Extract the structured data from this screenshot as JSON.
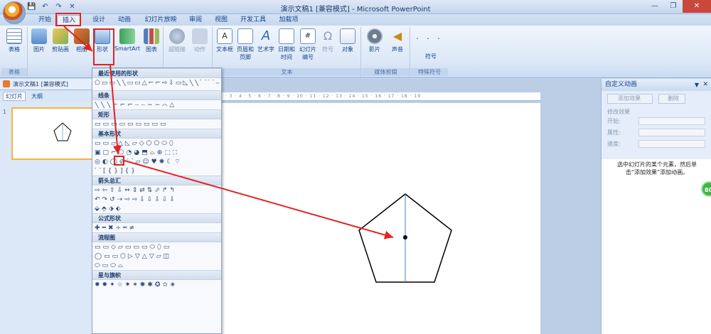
{
  "window": {
    "title": "演示文稿1 [兼容模式] - Microsoft PowerPoint",
    "qat_save": "💾",
    "qat_undo": "↶",
    "qat_redo": "↷",
    "qat_close": "✕",
    "minimize": "—",
    "restore": "❐",
    "close": "✕"
  },
  "ribbon_tabs": [
    "开始",
    "插入",
    "设计",
    "动画",
    "幻灯片放映",
    "审阅",
    "视图",
    "开发工具",
    "加载项"
  ],
  "ribbon": {
    "groups": [
      "表格",
      "插图",
      "链接",
      "文本",
      "媒体剪辑",
      "特殊符号"
    ],
    "buttons": {
      "table": "表格",
      "picture": "图片",
      "clipart": "剪贴画",
      "album": "相册",
      "shapes": "形状",
      "smartart": "SmartArt",
      "chart": "图表",
      "hyperlink": "超链接",
      "action": "动作",
      "textbox": "文本框",
      "header_footer": "页眉和页脚",
      "wordart": "艺术字",
      "datetime": "日期和时间",
      "slide_number": "幻灯片编号",
      "symbol": "符号",
      "object": "对象",
      "movie": "影片",
      "sound": "声音",
      "special_symbol": "符号"
    }
  },
  "left_pane": {
    "doc_tab": "演示文稿1 [兼容模式]",
    "tab_slides": "幻灯片",
    "tab_outline": "大纲",
    "slide_index": "1"
  },
  "ruler_text": "9 · 8 · 7 · 6 · 5 · 4 · 3 · 2 · 1 · 0 · 1 · 2 · 3 · 4 · 5 · 6 · 7 · 8 · 9 · 10 · 11 · 12 · 13 · 14 · 15 · 16 · 17 · 18 · 19",
  "shape_gallery": {
    "sections": [
      "最近使用的形状",
      "线条",
      "矩形",
      "基本形状",
      "箭头总汇",
      "公式形状",
      "流程图",
      "星与旗帜"
    ],
    "recent": "⬠▭▭╲╲▭▭△⌐⌐⇨⇩▭◺╲╲⌒⌒⌢{",
    "lines": "╲╲╲⌐⌐⌐ⵧⵧ∼∼⌒△",
    "rects": "▭▭▭▭▭▭▭▭▭",
    "basic_1": "▭▭▱△◺▱◇⬡⬠⬭⬯",
    "basic_2": "▣▢⌐⬠◔◕⬒⌓⊕⬚⛶",
    "basic_3": "◎◐◯⊘⌒▱☺♥✺☾⌔",
    "basic_4": "⌒[{}]{}",
    "arrows_1": "⇨⇦⇧⇩⇔⇕⇄⇅⬀↱↰",
    "arrows_2": "↶↷↺⇢⇨⇨⇩⇩⇩⇩⇩",
    "arrows_3": "⬙⬘⬗⬖",
    "equation": "✚━✖÷═≠",
    "flow_1": "▭▭◇▱▭▭▭⬭⬯▭",
    "flow_2": "◯▭▭⬡▷▽△▽▱◫",
    "flow_3": "⬭▭⬭⌓",
    "stars": "✸✹✦☆✷✶✺✱✪✫✬"
  },
  "animation_pane": {
    "title": "自定义动画",
    "add_effect": "添加效果",
    "remove": "删除",
    "modify_label": "修改效果",
    "start_label": "开始:",
    "property_label": "属性:",
    "speed_label": "速度:",
    "hint": "选中幻灯片的某个元素，然后单击“添加效果”添加动画。"
  },
  "badge": "80"
}
